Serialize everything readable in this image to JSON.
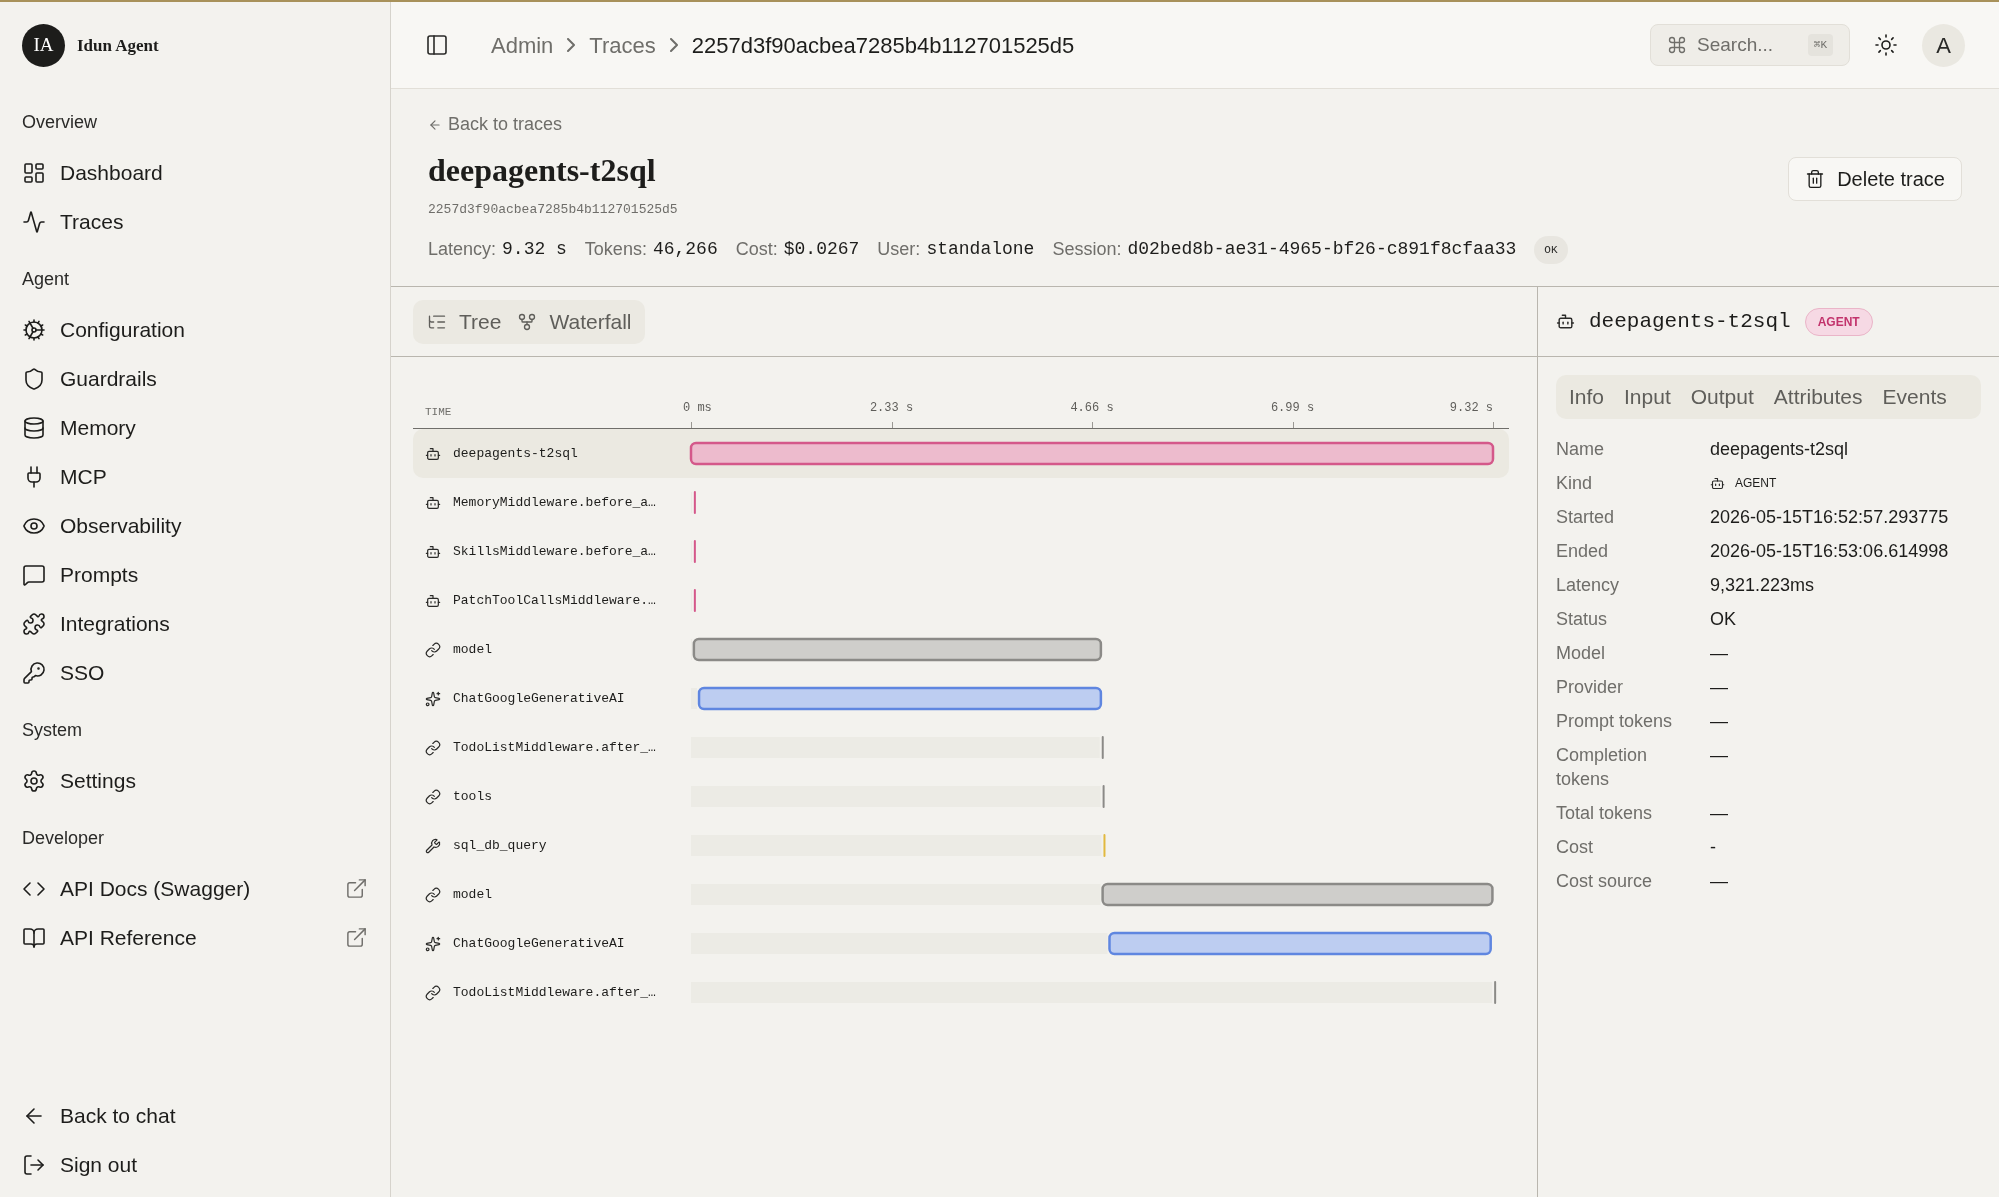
{
  "brand": {
    "initials": "IA",
    "name": "Idun Agent"
  },
  "sidebar": {
    "sections": [
      {
        "title": "Overview",
        "items": [
          {
            "label": "Dashboard"
          },
          {
            "label": "Traces"
          }
        ]
      },
      {
        "title": "Agent",
        "items": [
          {
            "label": "Configuration"
          },
          {
            "label": "Guardrails"
          },
          {
            "label": "Memory"
          },
          {
            "label": "MCP"
          },
          {
            "label": "Observability"
          },
          {
            "label": "Prompts"
          },
          {
            "label": "Integrations"
          },
          {
            "label": "SSO"
          }
        ]
      },
      {
        "title": "System",
        "items": [
          {
            "label": "Settings"
          }
        ]
      },
      {
        "title": "Developer",
        "items": [
          {
            "label": "API Docs (Swagger)",
            "external": true
          },
          {
            "label": "API Reference",
            "external": true
          }
        ]
      }
    ],
    "footer": [
      {
        "label": "Back to chat"
      },
      {
        "label": "Sign out"
      }
    ]
  },
  "breadcrumbs": [
    "Admin",
    "Traces",
    "2257d3f90acbea7285b4b112701525d5"
  ],
  "search": {
    "placeholder": "Search...",
    "shortcut": "⌘K"
  },
  "avatar": "A",
  "trace": {
    "back": "Back to traces",
    "title": "deepagents-t2sql",
    "id": "2257d3f90acbea7285b4b112701525d5",
    "delete": "Delete trace",
    "stats": [
      {
        "label": "Latency:",
        "value": "9.32 s"
      },
      {
        "label": "Tokens:",
        "value": "46,266"
      },
      {
        "label": "Cost:",
        "value": "$0.0267"
      },
      {
        "label": "User:",
        "value": "standalone"
      },
      {
        "label": "Session:",
        "value": "d02bed8b-ae31-4965-bf26-c891f8cfaa33"
      }
    ],
    "status": "OK"
  },
  "views": [
    "Tree",
    "Waterfall"
  ],
  "waterfall": {
    "time_label": "TIME",
    "spans": [
      {
        "kind": "agent",
        "selected": true
      },
      {
        "kind": "agent",
        "selected": false
      },
      {
        "kind": "agent",
        "selected": false
      },
      {
        "kind": "agent",
        "selected": false
      },
      {
        "kind": "chain",
        "selected": false
      },
      {
        "kind": "llm",
        "selected": false
      },
      {
        "kind": "chain",
        "selected": false
      },
      {
        "kind": "chain",
        "selected": false
      },
      {
        "kind": "tool",
        "selected": false
      },
      {
        "kind": "chain",
        "selected": false
      },
      {
        "kind": "llm",
        "selected": false
      },
      {
        "kind": "chain",
        "selected": false
      }
    ],
    "chart_data": {
      "type": "bar",
      "orientation": "horizontal",
      "categories": [
        "deepagents-t2sql",
        "MemoryMiddleware.before_a…",
        "SkillsMiddleware.before_a…",
        "PatchToolCallsMiddleware.…",
        "model",
        "ChatGoogleGenerativeAI",
        "TodoListMiddleware.after_…",
        "tools",
        "sql_db_query",
        "model",
        "ChatGoogleGenerativeAI",
        "TodoListMiddleware.after_…"
      ],
      "stacked": true,
      "series": [
        {
          "color": "#ecebe5",
          "values": [
            0,
            0.01,
            0.01,
            0.01,
            0.01,
            0.07,
            4.75,
            4.76,
            4.77,
            4.76,
            4.84,
            9.31
          ]
        },
        {
          "colors": [
            "#edbbcd",
            "#d4588a",
            "#d4588a",
            "#d4588a",
            "#cfcecb",
            "#bdcdf1",
            "#8b8a87",
            "#8b8a87",
            "#e2b93f",
            "#cfcecb",
            "#bdcdf1",
            "#8b8a87"
          ],
          "values": [
            9.32,
            0.01,
            0.01,
            0.01,
            4.73,
            4.67,
            0.01,
            0.01,
            0.01,
            4.53,
            4.43,
            0.01
          ]
        }
      ],
      "xlim": [
        0,
        9.32
      ],
      "xticks": [
        {
          "value": 0,
          "label": "0 ms"
        },
        {
          "value": 2.33,
          "label": "2.33 s"
        },
        {
          "value": 4.66,
          "label": "4.66 s"
        },
        {
          "value": 6.99,
          "label": "6.99 s"
        },
        {
          "value": 9.32,
          "label": "9.32 s"
        }
      ]
    }
  },
  "detail": {
    "name": "deepagents-t2sql",
    "badge": "AGENT",
    "tabs": [
      "Info",
      "Input",
      "Output",
      "Attributes",
      "Events"
    ],
    "fields": [
      {
        "label": "Name",
        "value": "deepagents-t2sql",
        "kind": "text"
      },
      {
        "label": "Kind",
        "value": "AGENT",
        "kind": "span-kind"
      },
      {
        "label": "Started",
        "value": "2026-05-15T16:52:57.293775",
        "kind": "text"
      },
      {
        "label": "Ended",
        "value": "2026-05-15T16:53:06.614998",
        "kind": "text"
      },
      {
        "label": "Latency",
        "value": "9,321.223ms",
        "kind": "text"
      },
      {
        "label": "Status",
        "value": "OK",
        "kind": "text"
      },
      {
        "label": "Model",
        "value": "—",
        "kind": "text"
      },
      {
        "label": "Provider",
        "value": "—",
        "kind": "text"
      },
      {
        "label": "Prompt tokens",
        "value": "—",
        "kind": "text"
      },
      {
        "label": "Completion tokens",
        "value": "—",
        "kind": "text"
      },
      {
        "label": "Total tokens",
        "value": "—",
        "kind": "text"
      },
      {
        "label": "Cost",
        "value": "-",
        "kind": "text"
      },
      {
        "label": "Cost source",
        "value": "—",
        "kind": "text"
      }
    ]
  }
}
